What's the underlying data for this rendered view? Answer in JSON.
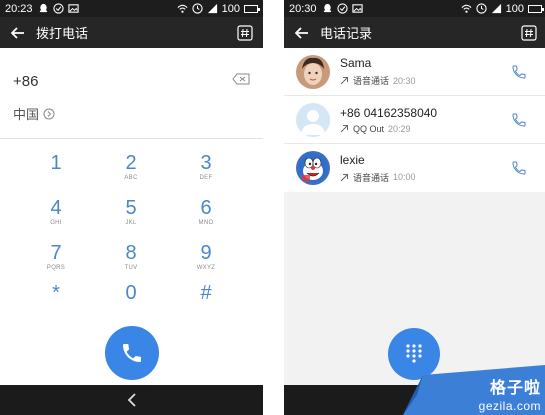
{
  "left": {
    "status": {
      "time": "20:23",
      "battery": "100"
    },
    "title": "拨打电话",
    "number": "+86",
    "country": "中国",
    "keys": [
      {
        "digit": "1",
        "letters": ""
      },
      {
        "digit": "2",
        "letters": "ABC"
      },
      {
        "digit": "3",
        "letters": "DEF"
      },
      {
        "digit": "4",
        "letters": "GHI"
      },
      {
        "digit": "5",
        "letters": "JKL"
      },
      {
        "digit": "6",
        "letters": "MNO"
      },
      {
        "digit": "7",
        "letters": "PQRS"
      },
      {
        "digit": "8",
        "letters": "TUV"
      },
      {
        "digit": "9",
        "letters": "WXYZ"
      },
      {
        "digit": "*",
        "letters": ""
      },
      {
        "digit": "0",
        "letters": ""
      },
      {
        "digit": "#",
        "letters": ""
      }
    ]
  },
  "right": {
    "status": {
      "time": "20:30",
      "battery": "100"
    },
    "title": "电话记录",
    "calls": [
      {
        "name": "Sama",
        "type": "语音通话",
        "time": "20:30",
        "avatar": "photo-avatar"
      },
      {
        "name": "+86 04162358040",
        "type": "QQ Out",
        "time": "20:29",
        "avatar": "default-avatar"
      },
      {
        "name": "lexie",
        "type": "语音通话",
        "time": "10:00",
        "avatar": "cartoon-avatar"
      }
    ]
  },
  "watermark": {
    "main": "格子啦",
    "sub": "gezila.com"
  },
  "colors": {
    "accent": "#3a86e6",
    "keyDigit": "#4a86c8",
    "appBar": "#262626",
    "statusBar": "#1d1d1d"
  }
}
